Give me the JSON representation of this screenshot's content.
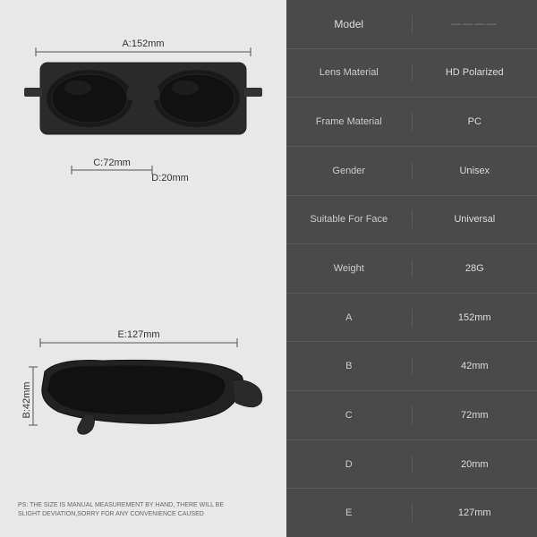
{
  "left": {
    "dimensions": {
      "a_label": "A:152mm",
      "c_label": "C:72mm",
      "d_label": "D:20mm",
      "e_label": "E:127mm",
      "b_label": "B:42mm"
    },
    "note": "PS: THE SIZE IS MANUAL MEASUREMENT BY HAND, THERE WILL BE SLIGHT DEVIATION,SORRY FOR ANY CONVENIENCE CAUSED"
  },
  "right": {
    "rows": [
      {
        "label": "Model",
        "value": "————"
      },
      {
        "label": "Lens Material",
        "value": "HD Polarized"
      },
      {
        "label": "Frame Material",
        "value": "PC"
      },
      {
        "label": "Gender",
        "value": "Unisex"
      },
      {
        "label": "Suitable For Face",
        "value": "Universal"
      },
      {
        "label": "Weight",
        "value": "28G"
      },
      {
        "label": "A",
        "value": "152mm"
      },
      {
        "label": "B",
        "value": "42mm"
      },
      {
        "label": "C",
        "value": "72mm"
      },
      {
        "label": "D",
        "value": "20mm"
      },
      {
        "label": "E",
        "value": "127mm"
      }
    ]
  }
}
